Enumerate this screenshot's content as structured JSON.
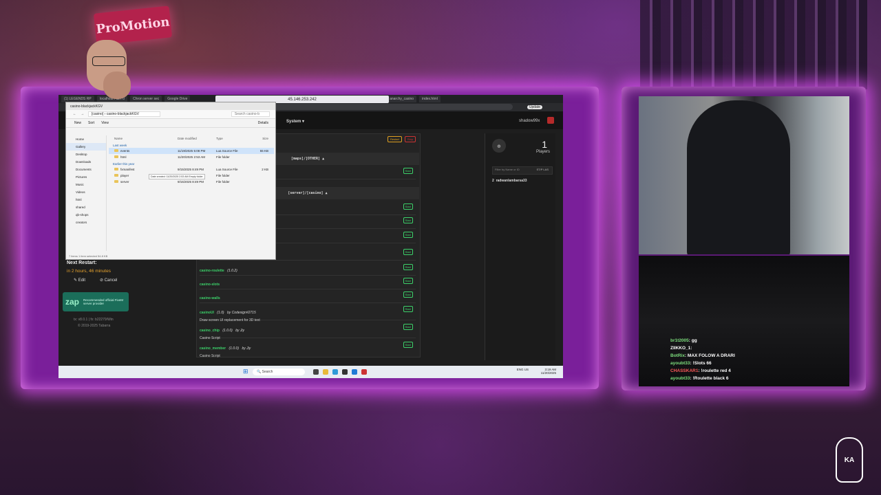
{
  "scene": {
    "sign_text": "ProMotion",
    "stream_logo": "KA"
  },
  "browser": {
    "tabs": [
      "(1) LEGENDS RP",
      "localhost / 127.0",
      "Chron server sec",
      "Google Drive",
      "Online Connections",
      "anarchy_casino",
      "index.html"
    ],
    "remote_ip": "45.146.253.242",
    "update_label": "Update"
  },
  "txadmin": {
    "nav_system": "System",
    "username": "shadow99x",
    "restart_label": "Restart",
    "stop_label": "Stop",
    "groups": [
      "[maps]/[OTHER]",
      "[server]/[casino]"
    ],
    "resources": [
      {
        "name": "casino-roulette",
        "version": "(1.0.2)",
        "author": "",
        "desc": ""
      },
      {
        "name": "casino-slots",
        "version": "",
        "author": "",
        "desc": ""
      },
      {
        "name": "casino-walls",
        "version": "",
        "author": "",
        "desc": ""
      },
      {
        "name": "casinoUI",
        "version": "(1.0)",
        "author": "by Codesign#2715",
        "desc": "Draw screen UI replacement for 3D text"
      },
      {
        "name": "casino_chip",
        "version": "(1.0.0)",
        "author": "by Jiy",
        "desc": "Casino Script"
      },
      {
        "name": "casino_member",
        "version": "(1.0.0)",
        "author": "by Jiy",
        "desc": "Casino Script"
      }
    ],
    "start_label": "Start",
    "next_restart_label": "Next Restart:",
    "next_restart_value": "in 2 hours, 46 minutes",
    "edit_label": "Edit",
    "cancel_label": "Cancel",
    "zap": {
      "logo": "zap",
      "text": "Recommended official FiveM server provider"
    },
    "version": "tx: v8.0.1 | fx: b22279/Win",
    "copyright": "© 2019-2025 Tabarra"
  },
  "players": {
    "count": "1",
    "label": "Players",
    "filter_placeholder": "Filter by Name or ID",
    "sort_label": "ST/P LAS",
    "list": [
      {
        "id": "2",
        "name": "radwanlambarsa33"
      }
    ]
  },
  "explorer": {
    "title": "casino-blackjackKGV",
    "path_root": "[casino]",
    "path_leaf": "casino-blackjackKGV",
    "search_placeholder": "Search casino-b",
    "toolbar": [
      "New",
      "Sort",
      "View",
      "Details"
    ],
    "sidebar": [
      "Home",
      "Gallery",
      "Desktop",
      "Downloads",
      "Documents",
      "Pictures",
      "Music",
      "Videos",
      "html",
      "shared",
      "qb-shops",
      "creators"
    ],
    "columns": [
      "Name",
      "Date modified",
      "Type",
      "Size"
    ],
    "groups": [
      "Last week",
      "Earlier this year"
    ],
    "rows_last_week": [
      {
        "name": "events",
        "date": "11/19/2025 5:08 PM",
        "type": "Lua Source File",
        "size": "55 KB"
      },
      {
        "name": "html",
        "date": "11/20/2025 2:53 AM",
        "type": "File folder",
        "size": ""
      }
    ],
    "rows_earlier": [
      {
        "name": "fxmanifest",
        "date": "9/15/2025 8:49 PM",
        "type": "Lua Source File",
        "size": "2 KB"
      },
      {
        "name": "player",
        "date": "9/15/2025 8:49 PM",
        "type": "File folder",
        "size": ""
      },
      {
        "name": "server",
        "date": "9/15/2025 8:49 PM",
        "type": "File folder",
        "size": ""
      }
    ],
    "tooltip": "Date created: 11/20/2025 2:53 AM Empty folder",
    "status": "7 items   1 item selected 54.8 KB"
  },
  "taskbar": {
    "search_label": "Search",
    "lang": "ENG US",
    "time": "3:19 AM",
    "date": "11/20/2025"
  },
  "chat": [
    {
      "user": "br1t2005",
      "msg": ": gg",
      "color": "green"
    },
    {
      "user": "ZIIKKO_1",
      "msg": ": ",
      "color": "white"
    },
    {
      "user": "BotRix",
      "msg": ": MAX FOLOW A DRARI",
      "color": "green"
    },
    {
      "user": "ayoubt33",
      "msg": ": !Slots 66",
      "color": "green"
    },
    {
      "user": "CHASSKAR1",
      "msg": ": !roulette red 4",
      "color": "red"
    },
    {
      "user": "ayoubt33",
      "msg": ": !Roulette black 6",
      "color": "green"
    }
  ]
}
